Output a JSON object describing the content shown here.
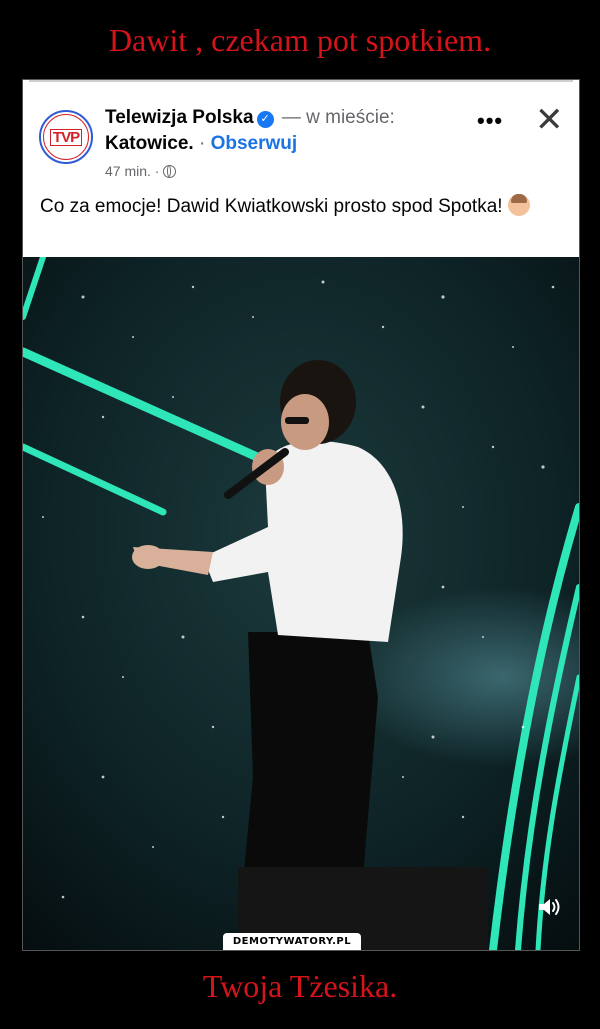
{
  "meme": {
    "top_caption": "Dawit , czekam pot spotkiem.",
    "bottom_caption": "Twoja Tżesika.",
    "watermark": "DEMOTYWATORY.PL"
  },
  "post": {
    "page_name": "Telewizja Polska",
    "location_prefix": "— w mieście:",
    "city": "Katowice.",
    "separator": "·",
    "follow_label": "Obserwuj",
    "time": "47 min. ·",
    "text": "Co za emocje! Dawid Kwiatkowski prosto spod Spotka!",
    "logo_text": "TVP",
    "more_label": "•••",
    "close_label": "✕",
    "verified_icon": "✓"
  },
  "colors": {
    "caption": "#d4131a",
    "link": "#1b74e4",
    "verified": "#1877f2",
    "stage_light": "#2ee6b8"
  }
}
